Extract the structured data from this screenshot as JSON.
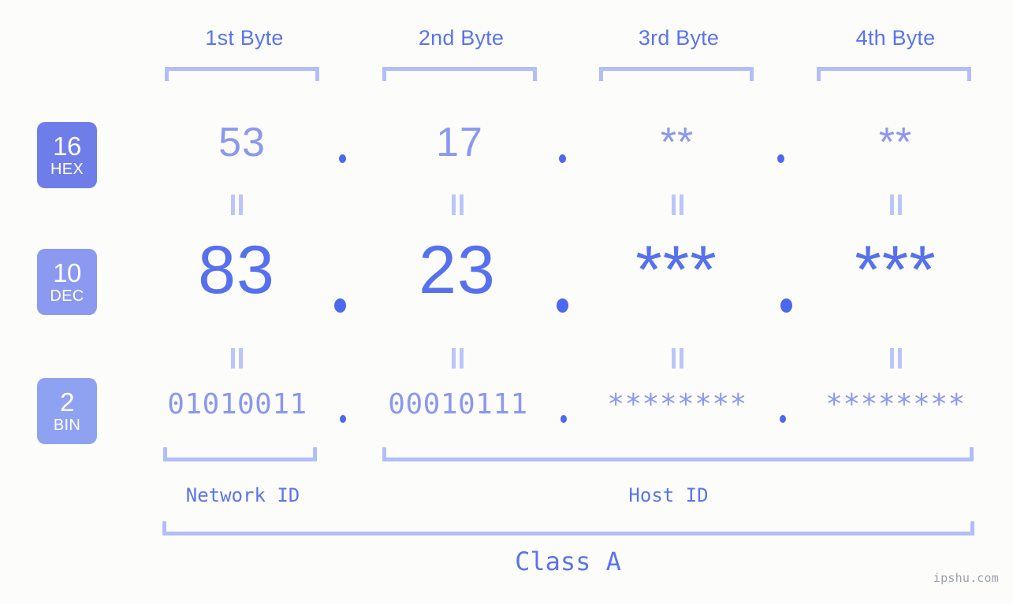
{
  "background_color": "#fcfdfa",
  "accent_colors": {
    "bracket": "#b3bdfa",
    "header_text": "#5b73f0",
    "hex_text": "#8a98f0",
    "dec_text": "#5670ee",
    "bin_text": "#8a98f0",
    "dot": "#4c68ef",
    "badge_hex_bg": "#6f7de9",
    "badge_dec_bg": "#8b99f0",
    "badge_bin_bg": "#8fa2f2",
    "watermark": "#9aa0a6"
  },
  "byte_headers": [
    {
      "label": "1st Byte"
    },
    {
      "label": "2nd Byte"
    },
    {
      "label": "3rd Byte"
    },
    {
      "label": "4th Byte"
    }
  ],
  "bases": [
    {
      "number": "16",
      "name": "HEX"
    },
    {
      "number": "10",
      "name": "DEC"
    },
    {
      "number": "2",
      "name": "BIN"
    }
  ],
  "rows": {
    "hex": {
      "base_number": "16",
      "base_name": "HEX",
      "values": [
        "53",
        "17",
        "**",
        "**"
      ]
    },
    "dec": {
      "base_number": "10",
      "base_name": "DEC",
      "values": [
        "83",
        "23",
        "***",
        "***"
      ]
    },
    "bin": {
      "base_number": "2",
      "base_name": "BIN",
      "values": [
        "01010011",
        "00010111",
        "********",
        "********"
      ]
    }
  },
  "separators": {
    "dot": ".",
    "equals": "="
  },
  "segments": {
    "network_id": "Network ID",
    "host_id": "Host ID"
  },
  "class_label": "Class A",
  "watermark": "ipshu.com"
}
